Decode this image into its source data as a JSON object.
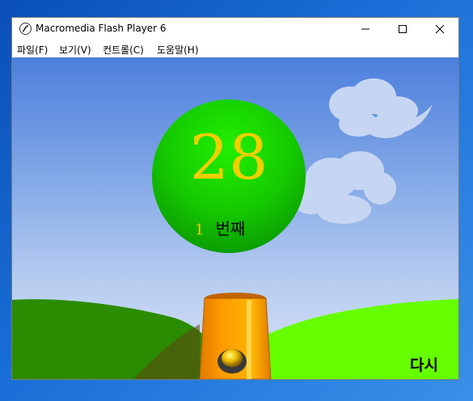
{
  "window": {
    "title": "Macromedia Flash Player 6",
    "icon": "flash-player-icon",
    "controls": [
      "minimize-icon",
      "maximize-icon",
      "close-icon"
    ]
  },
  "menu": {
    "items": [
      {
        "label": "파일(F)"
      },
      {
        "label": "보기(V)"
      },
      {
        "label": "컨트롤(C)"
      },
      {
        "label": "도움말(H)"
      }
    ]
  },
  "game": {
    "number": "28",
    "count": "1",
    "count_label": "번째",
    "again_label": "다시",
    "colors": {
      "ball": "#11b800",
      "number": "#f2cf00",
      "grass": "#66ff00",
      "cannon": "#ff9900"
    }
  }
}
